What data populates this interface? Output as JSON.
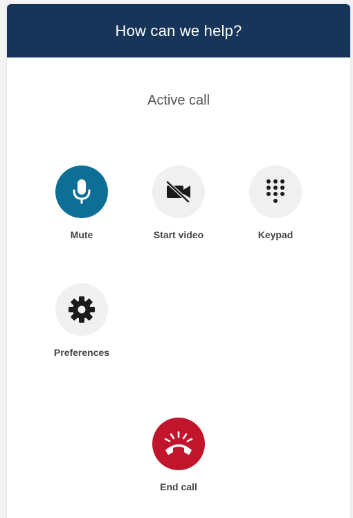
{
  "header": {
    "title": "How can we help?"
  },
  "status": {
    "text": "Active call"
  },
  "controls": {
    "mute": {
      "label": "Mute",
      "icon": "microphone-icon"
    },
    "video": {
      "label": "Start video",
      "icon": "video-off-icon"
    },
    "keypad": {
      "label": "Keypad",
      "icon": "dialpad-icon"
    },
    "preferences": {
      "label": "Preferences",
      "icon": "gear-icon"
    },
    "end_call": {
      "label": "End call",
      "icon": "hang-up-icon"
    }
  },
  "colors": {
    "header_bg": "#163559",
    "mute_active": "#0e6f96",
    "neutral_button": "#f0f0f0",
    "end_call": "#c0152b"
  }
}
